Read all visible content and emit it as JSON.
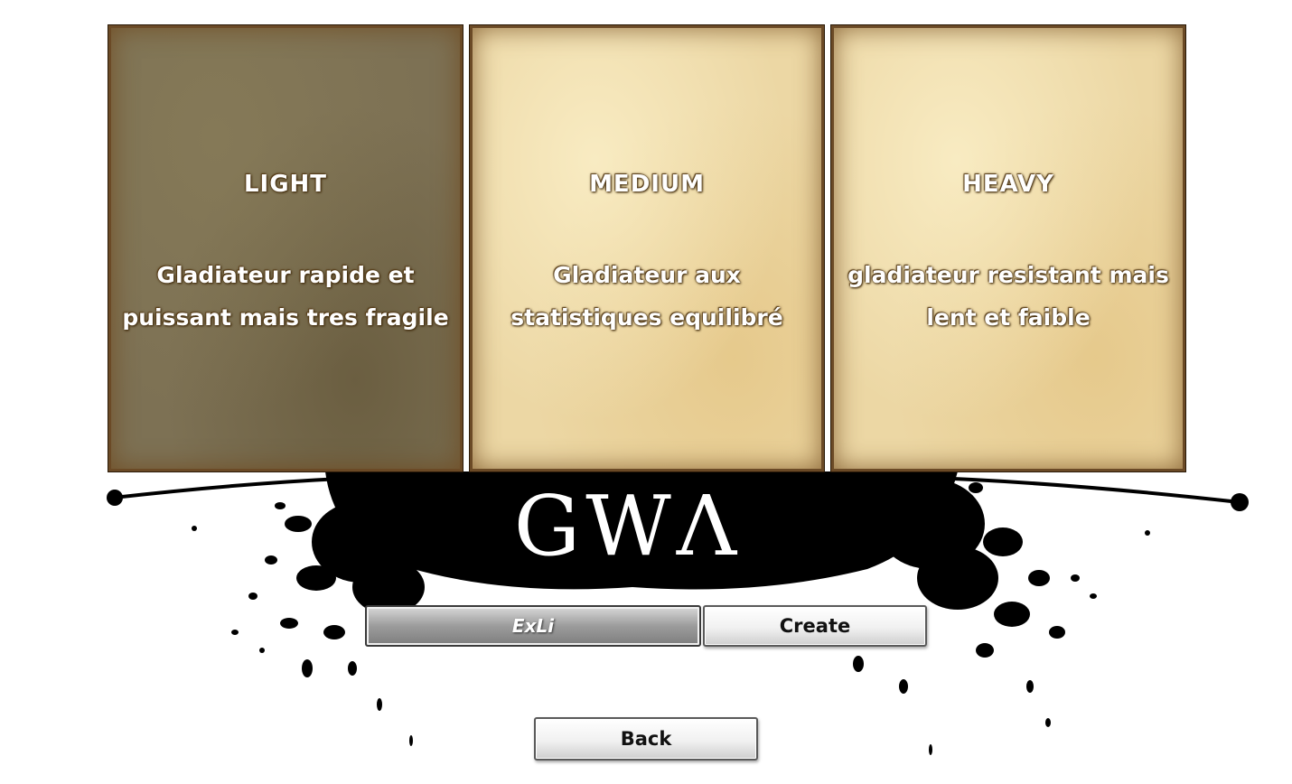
{
  "classes": [
    {
      "title": "LIGHT",
      "description_line1": "Gladiateur rapide et",
      "description_line2": "puissant mais tres fragile",
      "selected": true
    },
    {
      "title": "MEDIUM",
      "description_line1": "Gladiateur aux",
      "description_line2": "statistiques equilibré",
      "selected": false
    },
    {
      "title": "HEAVY",
      "description_line1": "gladiateur resistant mais",
      "description_line2": "lent et faible",
      "selected": false
    }
  ],
  "logo": {
    "text": "GWΛ"
  },
  "name_field": {
    "value": "ExLi"
  },
  "buttons": {
    "create_label": "Create",
    "back_label": "Back"
  },
  "colors": {
    "ink": "#000000",
    "parchment": "#ecd7a4",
    "parchment_selected": "#7d7154"
  }
}
